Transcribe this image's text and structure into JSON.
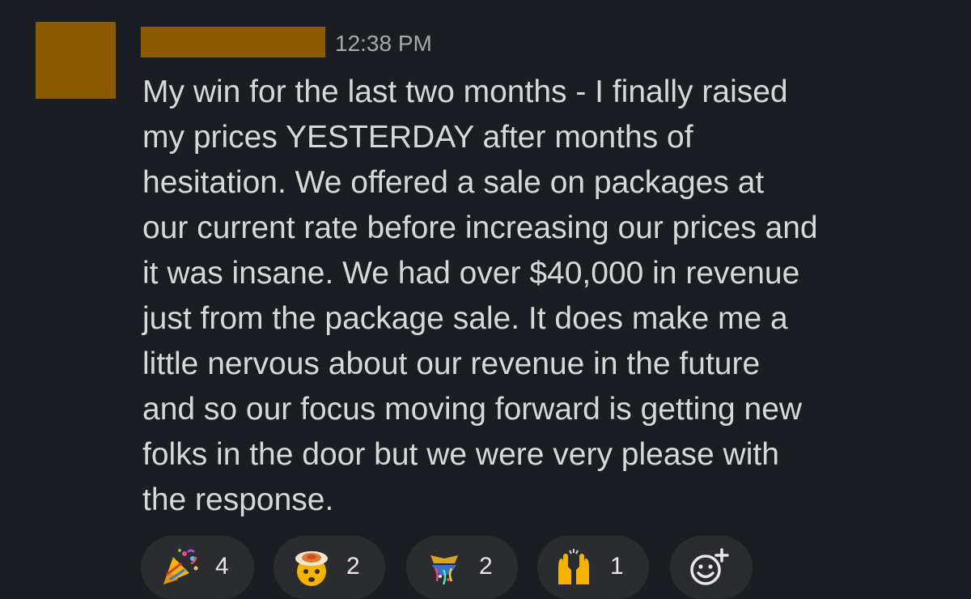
{
  "message": {
    "timestamp": "12:38 PM",
    "lines": [
      "My win for the last two months - I finally raised",
      "my prices YESTERDAY after months of",
      "hesitation.  We offered a sale on packages at",
      "our current rate before increasing our prices and",
      "it was insane.  We had over $40,000 in revenue",
      "just from the package sale.  It does make me a",
      "little nervous about our revenue in the future",
      "and so our focus moving forward is getting new",
      "folks in the door but we were very please with",
      "the response."
    ]
  },
  "reactions": [
    {
      "icon": "party-popper-icon",
      "count": "4"
    },
    {
      "icon": "exploding-head-icon",
      "count": "2"
    },
    {
      "icon": "confetti-ball-icon",
      "count": "2"
    },
    {
      "icon": "raising-hands-icon",
      "count": "1"
    }
  ],
  "add_reaction": {
    "icon": "add-reaction-icon"
  },
  "colors": {
    "background": "#1a1d21",
    "redaction": "#8b5a00",
    "reaction_pill": "#2a2c30",
    "text": "#d7d8da",
    "timestamp": "#a6a8ab"
  }
}
